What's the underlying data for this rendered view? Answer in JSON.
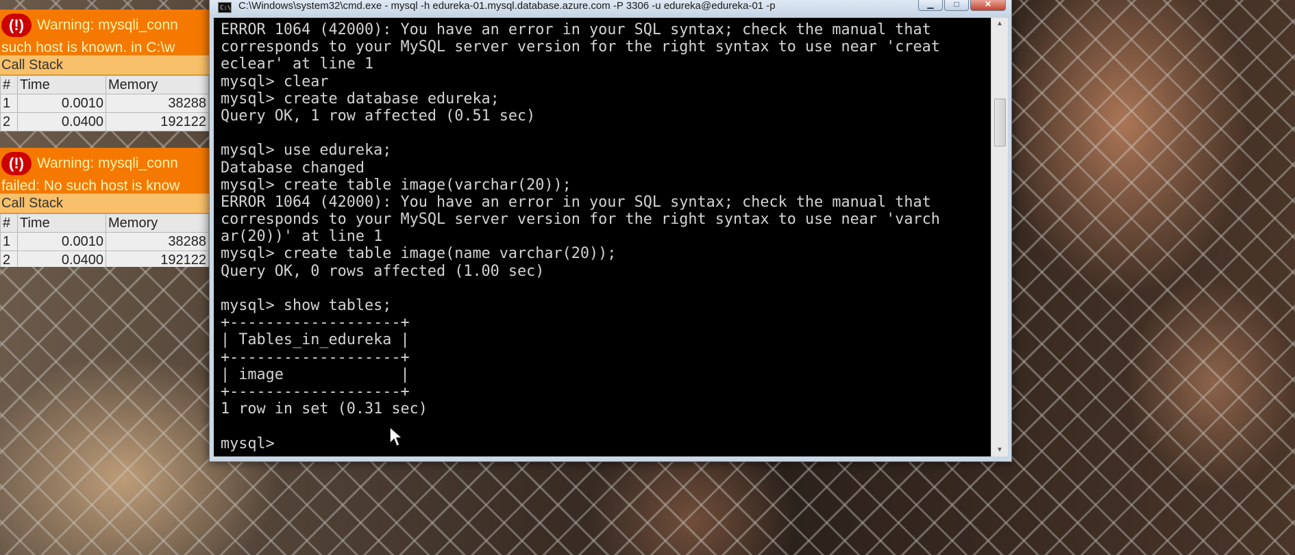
{
  "php_warnings": [
    {
      "icon": "(!)",
      "message_line1": "Warning: mysqli_conn",
      "message_line2": "such host is known. in C:\\w",
      "call_stack_label": "Call Stack",
      "columns": [
        "#",
        "Time",
        "Memory"
      ],
      "rows": [
        {
          "index": "1",
          "time": "0.0010",
          "memory": "38288"
        },
        {
          "index": "2",
          "time": "0.0400",
          "memory": "192122"
        }
      ]
    },
    {
      "icon": "(!)",
      "message_line1": "Warning: mysqli_conn",
      "message_line2": "failed: No such host is know",
      "call_stack_label": "Call Stack",
      "columns": [
        "#",
        "Time",
        "Memory"
      ],
      "rows": [
        {
          "index": "1",
          "time": "0.0010",
          "memory": "38288"
        },
        {
          "index": "2",
          "time": "0.0400",
          "memory": "192122"
        }
      ]
    }
  ],
  "cmd_window": {
    "title": "C:\\Windows\\system32\\cmd.exe - mysql  -h edureka-01.mysql.database.azure.com -P 3306 -u edureka@edureka-01 -p",
    "icon": "C:\\",
    "controls": {
      "minimize": "▁",
      "maximize": "□",
      "close": "✕"
    },
    "lines": [
      "ERROR 1064 (42000): You have an error in your SQL syntax; check the manual that",
      "corresponds to your MySQL server version for the right syntax to use near 'creat",
      "eclear' at line 1",
      "mysql> clear",
      "mysql> create database edureka;",
      "Query OK, 1 row affected (0.51 sec)",
      "",
      "mysql> use edureka;",
      "Database changed",
      "mysql> create table image(varchar(20));",
      "ERROR 1064 (42000): You have an error in your SQL syntax; check the manual that",
      "corresponds to your MySQL server version for the right syntax to use near 'varch",
      "ar(20))' at line 1",
      "mysql> create table image(name varchar(20));",
      "Query OK, 0 rows affected (1.00 sec)",
      "",
      "mysql> show tables;",
      "+-------------------+",
      "| Tables_in_edureka |",
      "+-------------------+",
      "| image             |",
      "+-------------------+",
      "1 row in set (0.31 sec)",
      "",
      "mysql>"
    ]
  },
  "colors": {
    "console_bg": "#000000",
    "console_text": "#d4d4d4",
    "warning_bg": "#f57900",
    "warning_icon": "#cc0000",
    "callstack_bg": "#f8c06a"
  }
}
